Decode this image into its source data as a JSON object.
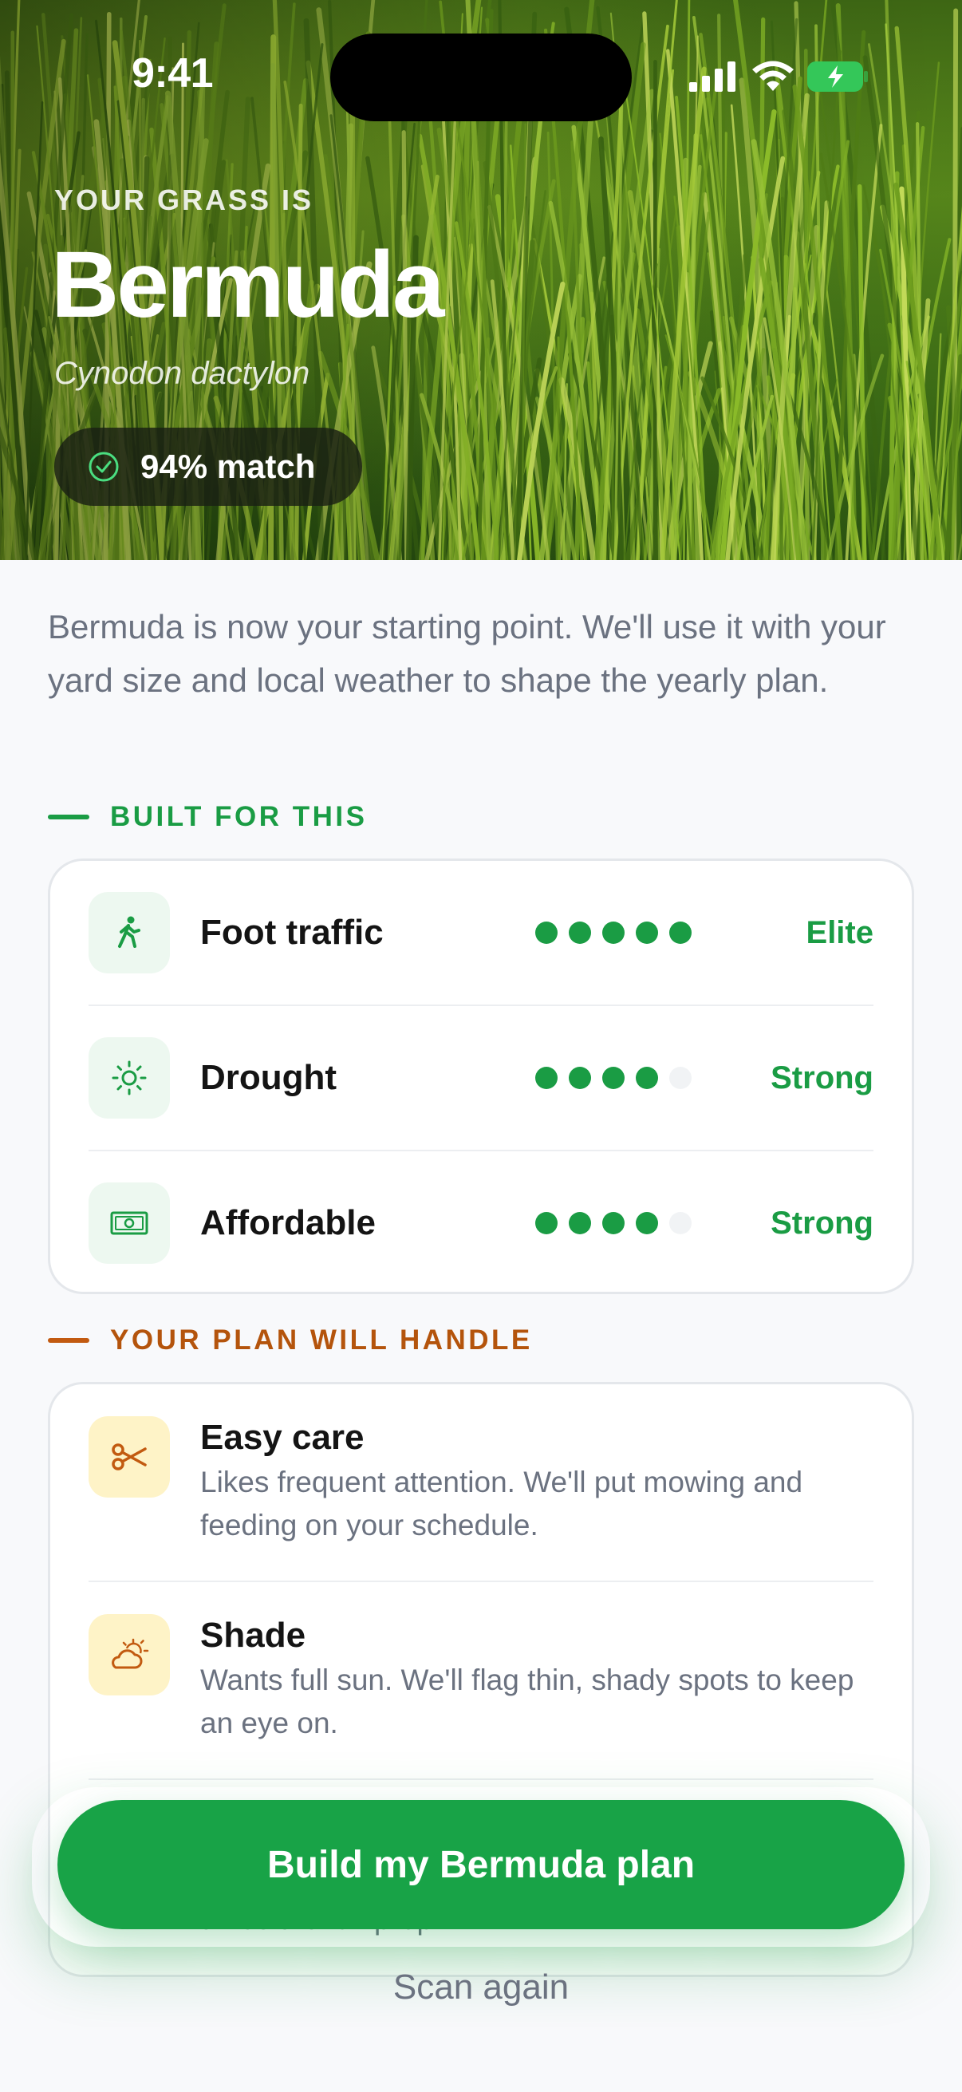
{
  "status_bar": {
    "time": "9:41",
    "battery_color": "#34c759"
  },
  "hero": {
    "eyebrow": "YOUR GRASS IS",
    "title": "Bermuda",
    "scientific_name": "Cynodon dactylon",
    "match_label": "94% match",
    "match_icon": "check-circle-icon"
  },
  "intro": "Bermuda is now your starting point. We'll use it with your yard size and local weather to shape the yearly plan.",
  "built_for": {
    "label": "BUILT FOR THIS",
    "accent": "#1a9c44",
    "traits": [
      {
        "icon": "walking-person-icon",
        "name": "Foot traffic",
        "level": 5,
        "max": 5,
        "rating": "Elite"
      },
      {
        "icon": "sun-icon",
        "name": "Drought",
        "level": 4,
        "max": 5,
        "rating": "Strong"
      },
      {
        "icon": "money-icon",
        "name": "Affordable",
        "level": 4,
        "max": 5,
        "rating": "Strong"
      }
    ]
  },
  "plan_handles": {
    "label": "YOUR PLAN WILL HANDLE",
    "accent": "#b4540c",
    "items": [
      {
        "icon": "scissors-icon",
        "title": "Easy care",
        "desc": "Likes frequent attention. We'll put mowing and feeding on your schedule."
      },
      {
        "icon": "cloud-sun-icon",
        "title": "Shade",
        "desc": "Wants full sun. We'll flag thin, shady spots to keep an eye on."
      }
    ],
    "partial_text": "times the fall prep."
  },
  "cta": {
    "label": "Build my Bermuda plan",
    "color": "#18a347"
  },
  "secondary": {
    "label": "Scan again"
  }
}
